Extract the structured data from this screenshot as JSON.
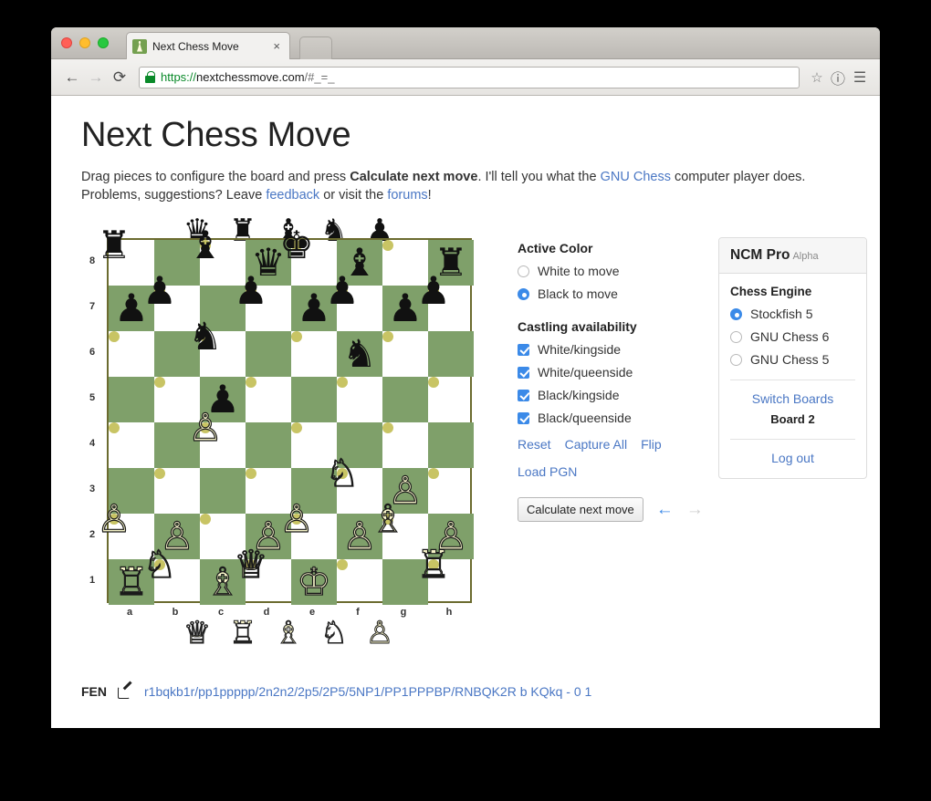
{
  "browser": {
    "tab_title": "Next Chess Move",
    "tab_close_glyph": "×",
    "favicon_name": "chess-pawn-favicon",
    "back_glyph": "←",
    "forward_glyph": "→",
    "reload_glyph": "⟳",
    "url_scheme": "https://",
    "url_host": "nextchessmove.com",
    "url_path": "/#_=_",
    "star_glyph": "☆",
    "info_glyph": "ⓘ",
    "menu_glyph": "☰"
  },
  "page": {
    "title": "Next Chess Move",
    "intro_1": "Drag pieces to configure the board and press ",
    "intro_bold": "Calculate next move",
    "intro_2": ". I'll tell you what the ",
    "intro_link_gnu": "GNU Chess",
    "intro_3": " computer player does.",
    "intro_4": "Problems, suggestions? Leave ",
    "intro_link_feedback": "feedback",
    "intro_5": " or visit the ",
    "intro_link_forums": "forums",
    "intro_6": "!"
  },
  "board": {
    "fen": "r1bqkb1r/pp1ppppp/2n2n2/2p5/2P5/5NP1/PP1PPPBP/RNBQK2R b KQkq - 0 1",
    "file_labels": [
      "a",
      "b",
      "c",
      "d",
      "e",
      "f",
      "g",
      "h"
    ],
    "rank_labels": [
      "8",
      "7",
      "6",
      "5",
      "4",
      "3",
      "2",
      "1"
    ],
    "light_square_color": "#c8c464",
    "dark_square_color": "#7fa06a",
    "rows": [
      [
        "♜",
        "",
        "♝",
        "♛",
        "♚",
        "♝",
        "",
        "♜"
      ],
      [
        "♟",
        "♟",
        "",
        "♟",
        "♟",
        "♟",
        "♟",
        "♟"
      ],
      [
        "",
        "",
        "♞",
        "",
        "",
        "♞",
        "",
        ""
      ],
      [
        "",
        "",
        "♟",
        "",
        "",
        "",
        "",
        ""
      ],
      [
        "",
        "",
        "♙",
        "",
        "",
        "",
        "",
        ""
      ],
      [
        "",
        "",
        "",
        "",
        "",
        "♘",
        "♙",
        ""
      ],
      [
        "♙",
        "♙",
        "",
        "♙",
        "♙",
        "♙",
        "♗",
        "♙"
      ],
      [
        "♖",
        "♘",
        "♗",
        "♕",
        "♔",
        "",
        "",
        "♖"
      ]
    ],
    "row_colors": [
      [
        "p",
        "b",
        "p",
        "b",
        "p",
        "b",
        "p",
        "b"
      ]
    ],
    "spare_black": [
      "♛",
      "♜",
      "♝",
      "♞",
      "♟"
    ],
    "spare_white": [
      "♕",
      "♖",
      "♗",
      "♘",
      "♙"
    ]
  },
  "controls": {
    "active_color_head": "Active Color",
    "white_to_move": "White to move",
    "black_to_move": "Black to move",
    "active_color_selected": "black",
    "castling_head": "Castling availability",
    "castling": [
      {
        "label": "White/kingside",
        "checked": true
      },
      {
        "label": "White/queenside",
        "checked": true
      },
      {
        "label": "Black/kingside",
        "checked": true
      },
      {
        "label": "Black/queenside",
        "checked": true
      }
    ],
    "reset": "Reset",
    "capture_all": "Capture All",
    "flip": "Flip",
    "load_pgn": "Load PGN",
    "calculate": "Calculate next move",
    "prev_arrow": "←",
    "next_arrow": "→",
    "accent_color": "#3b8ae8",
    "link_color": "#4a77c4"
  },
  "ncm": {
    "title": "NCM Pro",
    "alpha": "Alpha",
    "engine_head": "Chess Engine",
    "engines": [
      {
        "label": "Stockfish 5",
        "selected": true
      },
      {
        "label": "GNU Chess 6",
        "selected": false
      },
      {
        "label": "GNU Chess 5",
        "selected": false
      }
    ],
    "switch_boards": "Switch Boards",
    "board_label": "Board 2",
    "log_out": "Log out"
  },
  "fen": {
    "label": "FEN",
    "edit_icon": "edit-pencil-icon",
    "value": "r1bqkb1r/pp1ppppp/2n2n2/2p5/2P5/5NP1/PP1PPPBP/RNBQK2R b KQkq - 0 1"
  }
}
